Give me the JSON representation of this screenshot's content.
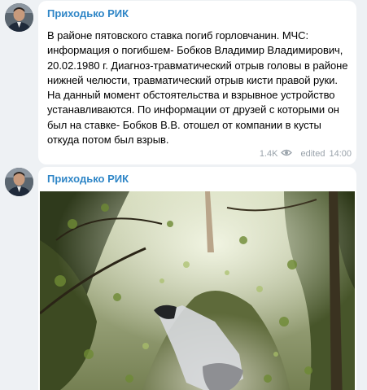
{
  "messages": [
    {
      "author": "Приходько РИК",
      "text": "В районе пятовского ставка погиб горловчанин. МЧС: информация о погибшем- Бобков Владимир Владимирович, 20.02.1980 г. Диагноз-травматический отрыв головы в районе нижней челюсти, травматический отрыв кисти правой руки. На данный момент обстоятельства и взрывное устройство устанавливаются. По информации от друзей с которыми он был на ставке- Бобков В.В. отошел от компании в кусты откуда потом был взрыв.",
      "views": "1.4K",
      "edited_label": "edited",
      "time": "14:00",
      "icons": {
        "views": "eye-icon",
        "avatar": "avatar-photo"
      }
    },
    {
      "author": "Приходько РИК",
      "photo": "forest-path-photo"
    }
  ],
  "colors": {
    "author": "#2f86c7",
    "meta": "#9aa3ab",
    "background": "#eef1f4",
    "bubble": "#ffffff"
  }
}
